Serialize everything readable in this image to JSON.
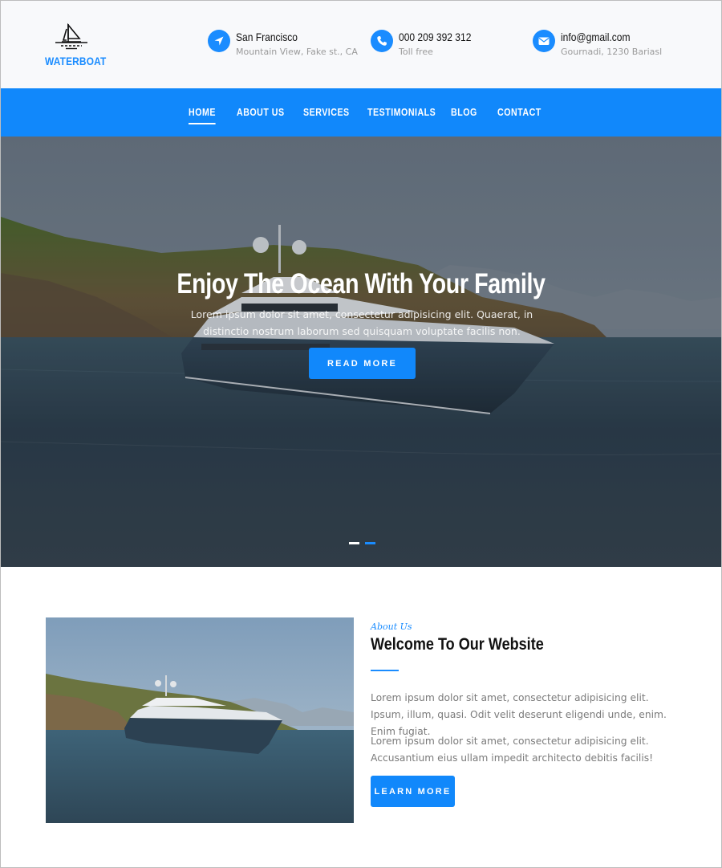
{
  "brand": {
    "name": "WATERBOAT",
    "logo_icon": "sailboat-icon",
    "accent_color": "#1188fb"
  },
  "header": {
    "contacts": [
      {
        "icon": "location-arrow-icon",
        "title": "San Francisco",
        "subtitle": "Mountain View, Fake st., CA"
      },
      {
        "icon": "phone-icon",
        "title": "000 209 392 312",
        "subtitle": "Toll free"
      },
      {
        "icon": "envelope-icon",
        "title": "info@gmail.com",
        "subtitle": "Gournadi, 1230 Bariasl"
      }
    ]
  },
  "nav": {
    "items": [
      {
        "label": "HOME",
        "active": true
      },
      {
        "label": "ABOUT US",
        "active": false
      },
      {
        "label": "SERVICES",
        "active": false
      },
      {
        "label": "TESTIMONIALS",
        "active": false
      },
      {
        "label": "BLOG",
        "active": false
      },
      {
        "label": "CONTACT",
        "active": false
      }
    ]
  },
  "hero": {
    "title": "Enjoy The Ocean With Your Family",
    "subtitle": "Lorem ipsum dolor sit amet, consectetur adipisicing elit. Quaerat, in distinctio nostrum laborum sed quisquam voluptate facilis non.",
    "button_label": "READ MORE",
    "image_alt": "Luxury yacht anchored near a green rocky island",
    "slides": 2,
    "active_slide": 2
  },
  "about": {
    "kicker": "About Us",
    "title": "Welcome To Our Website",
    "paragraphs": [
      "Lorem ipsum dolor sit amet, consectetur adipisicing elit. Ipsum, illum, quasi. Odit velit deserunt eligendi unde, enim. Enim fugiat.",
      "Lorem ipsum dolor sit amet, consectetur adipisicing elit. Accusantium eius ullam impedit architecto debitis facilis!"
    ],
    "button_label": "LEARN MORE",
    "image_alt": "Yacht on the sea near an island"
  }
}
